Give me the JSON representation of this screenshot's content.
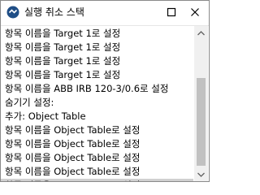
{
  "window": {
    "title": "실행 취소 스택",
    "app_icon": "app-logo-icon",
    "controls": {
      "restore": "restore-icon",
      "close": "close-icon"
    }
  },
  "undo_stack": {
    "items": [
      "항목 이름을 Target 1로 설정",
      "항목 이름을 Target 1로 설정",
      "항목 이름을 Target 1로 설정",
      "항목 이름을 Target 1로 설정",
      "항목 이름을 ABB IRB 120-3/0.6로 설정",
      "숨기기 설정:",
      "추가: Object Table",
      "항목 이름을 Object Table로 설정",
      "항목 이름을 Object Table로 설정",
      "항목 이름을 Object Table로 설정",
      "항목 이름을 Object Table로 설정",
      "항목 이름을 Object Table로 설정"
    ],
    "selected_index": 11
  },
  "scrollbar": {
    "position": 0.62
  }
}
